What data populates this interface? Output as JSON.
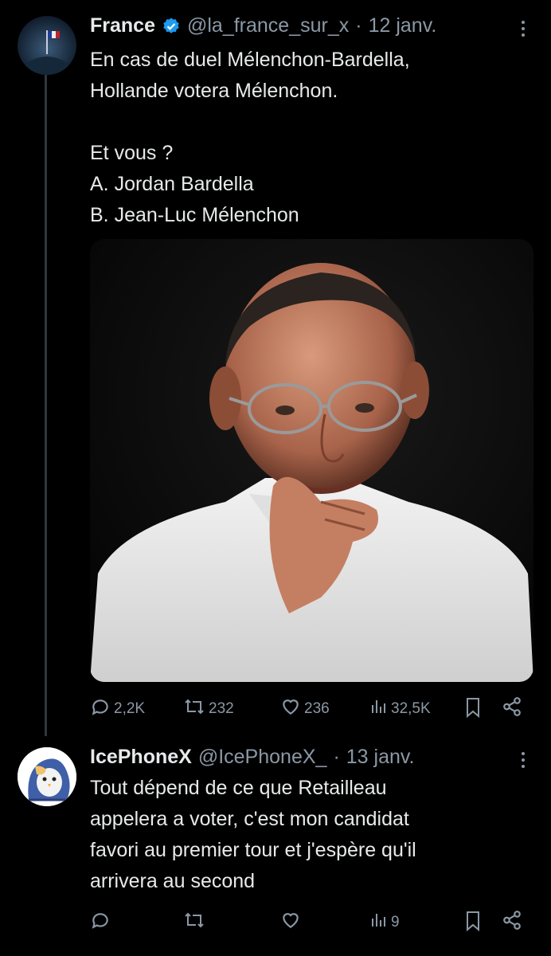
{
  "tweet1": {
    "author_name": "France",
    "handle": "@la_france_sur_x",
    "date_sep": "·",
    "date": "12 janv.",
    "text": "En cas de duel Mélenchon-Bardella,\nHollande votera Mélenchon.\n\nEt vous ?\nA. Jordan Bardella\nB. Jean-Luc Mélenchon",
    "metrics": {
      "replies": "2,2K",
      "retweets": "232",
      "likes": "236",
      "views": "32,5K"
    }
  },
  "tweet2": {
    "author_name": "IcePhoneX",
    "handle": "@IcePhoneX_",
    "date_sep": "·",
    "date": "13 janv.",
    "text": "Tout dépend de ce que Retailleau\nappelera a voter, c'est mon candidat\nfavori au premier tour et j'espère qu'il\narrivera au second",
    "metrics": {
      "views": "9"
    }
  },
  "colors": {
    "background": "#000000",
    "text": "#e7e9ea",
    "secondary": "#8b98a5",
    "verified": "#1d9bf0"
  }
}
